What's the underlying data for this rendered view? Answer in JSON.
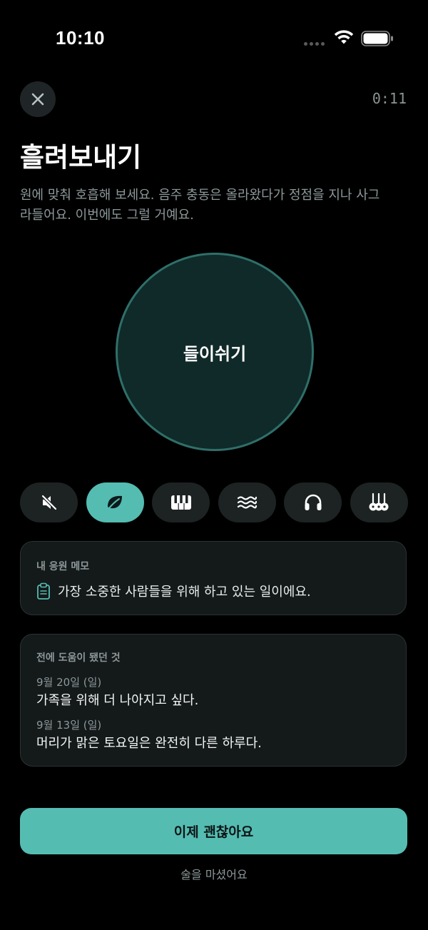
{
  "status_bar": {
    "time": "10:10"
  },
  "header": {
    "timer": "0:11"
  },
  "title": "흘려보내기",
  "description": "원에 맞춰 호흡해 보세요. 음주 충동은 올라왔다가 정점을 지나 사그라들어요. 이번에도 그럴 거예요.",
  "breath": {
    "phase_label": "들이쉬기"
  },
  "sound_options": [
    {
      "icon": "mute-icon",
      "active": false
    },
    {
      "icon": "leaf-icon",
      "active": true
    },
    {
      "icon": "piano-icon",
      "active": false
    },
    {
      "icon": "waves-icon",
      "active": false
    },
    {
      "icon": "headphones-icon",
      "active": false
    },
    {
      "icon": "guitars-icon",
      "active": false
    }
  ],
  "memo": {
    "label": "내 응원 메모",
    "text": "가장 소중한 사람들을 위해 하고 있는 일이에요."
  },
  "history": {
    "label": "전에 도움이 됐던 것",
    "entries": [
      {
        "date": "9월 20일 (일)",
        "text": "가족을 위해 더 나아지고 싶다."
      },
      {
        "date": "9월 13일 (일)",
        "text": "머리가 맑은 토요일은 완전히 다른 하루다."
      }
    ]
  },
  "actions": {
    "primary": "이제 괜찮아요",
    "secondary": "술을 마셨어요"
  },
  "colors": {
    "accent": "#55bcb2",
    "background": "#000000",
    "card": "#14191a",
    "circle": "#0f2a29"
  }
}
